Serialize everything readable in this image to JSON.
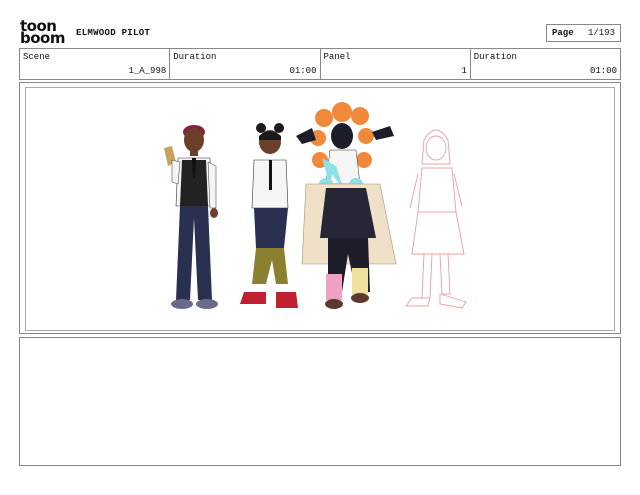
{
  "logo": {
    "line1": "toon",
    "line2": "boom"
  },
  "project_title": "ELMWOOD PILOT",
  "page": {
    "label": "Page",
    "value": "1/193"
  },
  "info": [
    {
      "label": "Scene",
      "value": "1_A_998"
    },
    {
      "label": "Duration",
      "value": "01:00"
    },
    {
      "label": "Panel",
      "value": "1"
    },
    {
      "label": "Duration",
      "value": "01:00"
    }
  ],
  "colors": {
    "border": "#888888",
    "skin": "#6b3f2a",
    "hair_orange": "#f08a3a",
    "sketch_red": "#e8a0a0",
    "cyan": "#8ee0e8"
  },
  "notes": ""
}
